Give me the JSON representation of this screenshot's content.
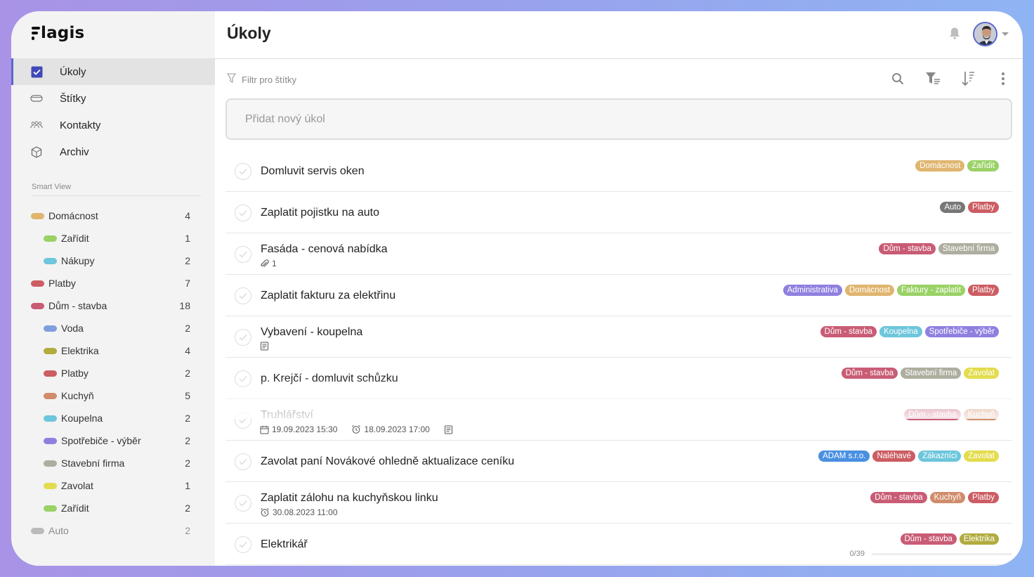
{
  "app": {
    "logo_text": "lagis"
  },
  "nav": [
    {
      "label": "Úkoly",
      "icon": "checkbox-icon",
      "active": true
    },
    {
      "label": "Štítky",
      "icon": "tag-icon",
      "active": false
    },
    {
      "label": "Kontakty",
      "icon": "contacts-icon",
      "active": false
    },
    {
      "label": "Archiv",
      "icon": "archive-icon",
      "active": false
    }
  ],
  "smart_view": {
    "title": "Smart View",
    "items": [
      {
        "label": "Domácnost",
        "count": "4",
        "color": "#e0b56f",
        "level": 0
      },
      {
        "label": "Zařídit",
        "count": "1",
        "color": "#9ad266",
        "level": 1
      },
      {
        "label": "Nákupy",
        "count": "2",
        "color": "#6cc6dc",
        "level": 1
      },
      {
        "label": "Platby",
        "count": "7",
        "color": "#cc5d63",
        "level": 0
      },
      {
        "label": "Dům - stavba",
        "count": "18",
        "color": "#c95c75",
        "level": 0
      },
      {
        "label": "Voda",
        "count": "2",
        "color": "#7f9edc",
        "level": 1
      },
      {
        "label": "Elektrika",
        "count": "4",
        "color": "#b2ab3e",
        "level": 1
      },
      {
        "label": "Platby",
        "count": "2",
        "color": "#cc5d63",
        "level": 1
      },
      {
        "label": "Kuchyň",
        "count": "5",
        "color": "#d08c6b",
        "level": 1
      },
      {
        "label": "Koupelna",
        "count": "2",
        "color": "#6cc6dc",
        "level": 1
      },
      {
        "label": "Spotřebiče - výběr",
        "count": "2",
        "color": "#8f80e0",
        "level": 1
      },
      {
        "label": "Stavební firma",
        "count": "2",
        "color": "#aeaea0",
        "level": 1
      },
      {
        "label": "Zavolat",
        "count": "1",
        "color": "#e3dc4e",
        "level": 1
      },
      {
        "label": "Zařídit",
        "count": "2",
        "color": "#9ad266",
        "level": 1
      },
      {
        "label": "Auto",
        "count": "2",
        "color": "#8c8c8c",
        "level": 0
      }
    ]
  },
  "header": {
    "title": "Úkoly"
  },
  "filter": {
    "placeholder": "Filtr pro štítky"
  },
  "new_task": {
    "placeholder": "Přidat nový úkol"
  },
  "tag_colors": {
    "Domácnost": "#e0b56f",
    "Zařídit": "#9ad266",
    "Auto": "#777777",
    "Platby": "#cc5d63",
    "Dům - stavba": "#c95c75",
    "Stavební firma": "#aeaea0",
    "Administrativa": "#8f80e0",
    "Faktury - zaplatit": "#9ad266",
    "Koupelna": "#6cc6dc",
    "Spotřebiče - výběr": "#8f80e0",
    "Zavolat": "#e3dc4e",
    "Kuchyň": "#d08c6b",
    "ADAM s.r.o.": "#4a90e2",
    "Naléhavé": "#cc5d63",
    "Zákazníci": "#6cc6dc",
    "Elektrika": "#b2ab3e"
  },
  "tasks": [
    {
      "title": "Domluvit servis oken",
      "tags": [
        "Domácnost",
        "Zařídit"
      ],
      "meta": null
    },
    {
      "title": "Zaplatit pojistku na auto",
      "tags": [
        "Auto",
        "Platby"
      ],
      "meta": null
    },
    {
      "title": "Fasáda - cenová nabídka",
      "tags": [
        "Dům - stavba",
        "Stavební firma"
      ],
      "meta": {
        "attachments": "1"
      }
    },
    {
      "title": "Zaplatit fakturu za elektřinu",
      "tags": [
        "Administrativa",
        "Domácnost",
        "Faktury - zaplatit",
        "Platby"
      ],
      "meta": null
    },
    {
      "title": "Vybavení - koupelna",
      "tags": [
        "Dům - stavba",
        "Koupelna",
        "Spotřebiče - výběr"
      ],
      "meta": {
        "note": true
      }
    },
    {
      "title": "p. Krejčí - domluvit schůzku",
      "tags": [
        "Dům - stavba",
        "Stavební firma",
        "Zavolat"
      ],
      "meta": null
    },
    {
      "title": "Truhlářství",
      "tags": [
        "Dům - stavba",
        "Kuchyň"
      ],
      "meta": {
        "due": "19.09.2023 15:30",
        "reminder": "18.09.2023 17:00",
        "note": true
      }
    },
    {
      "title": "Zavolat paní Novákové ohledně aktualizace ceníku",
      "tags": [
        "ADAM s.r.o.",
        "Naléhavé",
        "Zákazníci",
        "Zavolat"
      ],
      "meta": null
    },
    {
      "title": "Zaplatit zálohu na kuchyňskou linku",
      "tags": [
        "Dům - stavba",
        "Kuchyň",
        "Platby"
      ],
      "meta": {
        "reminder": "30.08.2023 11:00"
      }
    },
    {
      "title": "Elektrikář",
      "tags": [
        "Dům - stavba",
        "Elektrika"
      ],
      "meta": null
    }
  ],
  "progress": {
    "text": "0/39",
    "value": 0
  }
}
